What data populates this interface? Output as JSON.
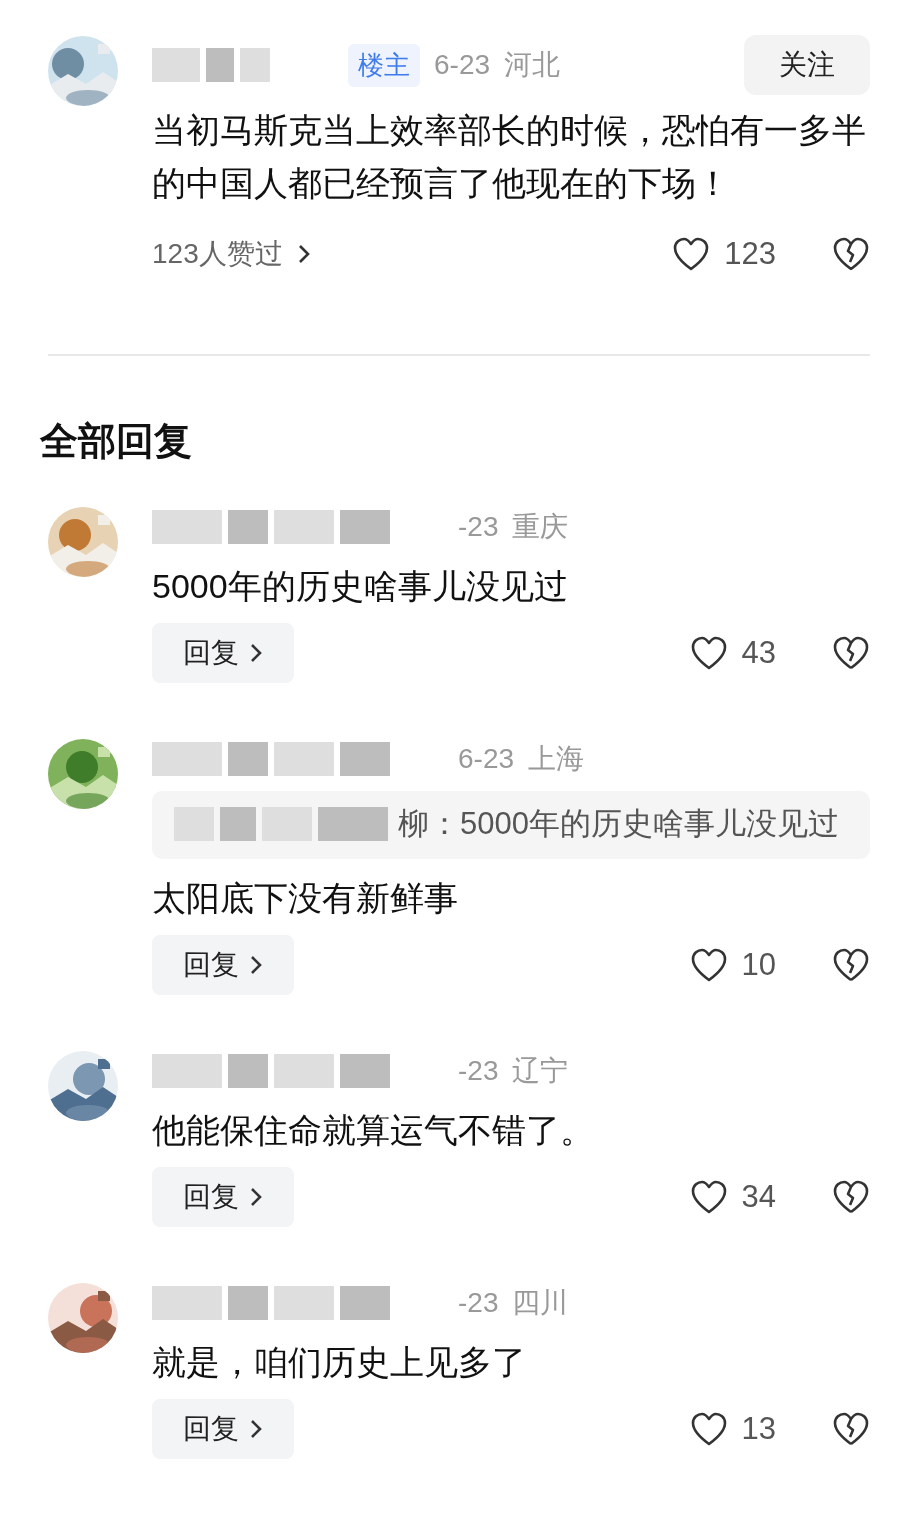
{
  "post": {
    "badge": "楼主",
    "date": "6-23",
    "region": "河北",
    "follow_button": "关注",
    "text": "当初马斯克当上效率部长的时候，恐怕有一多半的中国人都已经预言了他现在的下场！",
    "likers": "123人赞过",
    "likes": "123"
  },
  "section_title": "全部回复",
  "replies": [
    {
      "date": "-23",
      "region": "重庆",
      "text": "5000年的历史啥事儿没见过",
      "reply_button": "回复",
      "likes": "43"
    },
    {
      "date": "6-23",
      "region": "上海",
      "quote": "柳：5000年的历史啥事儿没见过",
      "text": "太阳底下没有新鲜事",
      "reply_button": "回复",
      "likes": "10"
    },
    {
      "date": "-23",
      "region": "辽宁",
      "text": "他能保住命就算运气不错了。",
      "reply_button": "回复",
      "likes": "34"
    },
    {
      "date": "-23",
      "region": "四川",
      "text": "就是，咱们历史上见多了",
      "reply_button": "回复",
      "likes": "13"
    }
  ]
}
